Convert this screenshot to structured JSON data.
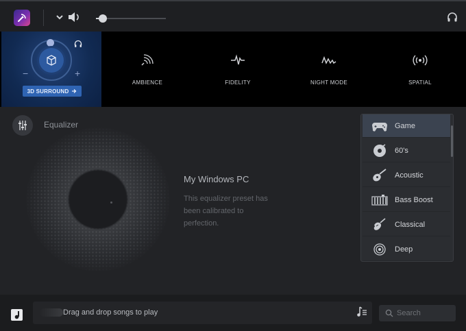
{
  "player": {
    "volume_percent": 10
  },
  "surround": {
    "button_label": "3D SURROUND",
    "minus": "−",
    "plus": "+"
  },
  "effects": [
    {
      "label": "AMBIENCE",
      "icon": "ambience-icon"
    },
    {
      "label": "FIDELITY",
      "icon": "fidelity-icon"
    },
    {
      "label": "NIGHT MODE",
      "icon": "night-mode-icon"
    },
    {
      "label": "SPATIAL",
      "icon": "spatial-icon"
    }
  ],
  "equalizer": {
    "title": "Equalizer",
    "preset_name": "My Windows PC",
    "preset_description": "This equalizer preset has been calibrated to perfection.",
    "presets": [
      {
        "label": "Game",
        "icon": "gamepad-icon",
        "selected": true
      },
      {
        "label": "60's",
        "icon": "vinyl-record-icon",
        "selected": false
      },
      {
        "label": "Acoustic",
        "icon": "acoustic-guitar-icon",
        "selected": false
      },
      {
        "label": "Bass Boost",
        "icon": "equalizer-bars-icon",
        "selected": false
      },
      {
        "label": "Classical",
        "icon": "violin-icon",
        "selected": false
      },
      {
        "label": "Deep",
        "icon": "spiral-icon",
        "selected": false
      }
    ]
  },
  "bottom": {
    "drop_text": "Drag and drop songs to play",
    "search_placeholder": "Search"
  },
  "colors": {
    "accent": "#2f64b3",
    "surround_panel": "#112a52",
    "selected_preset": "#3b4350"
  }
}
